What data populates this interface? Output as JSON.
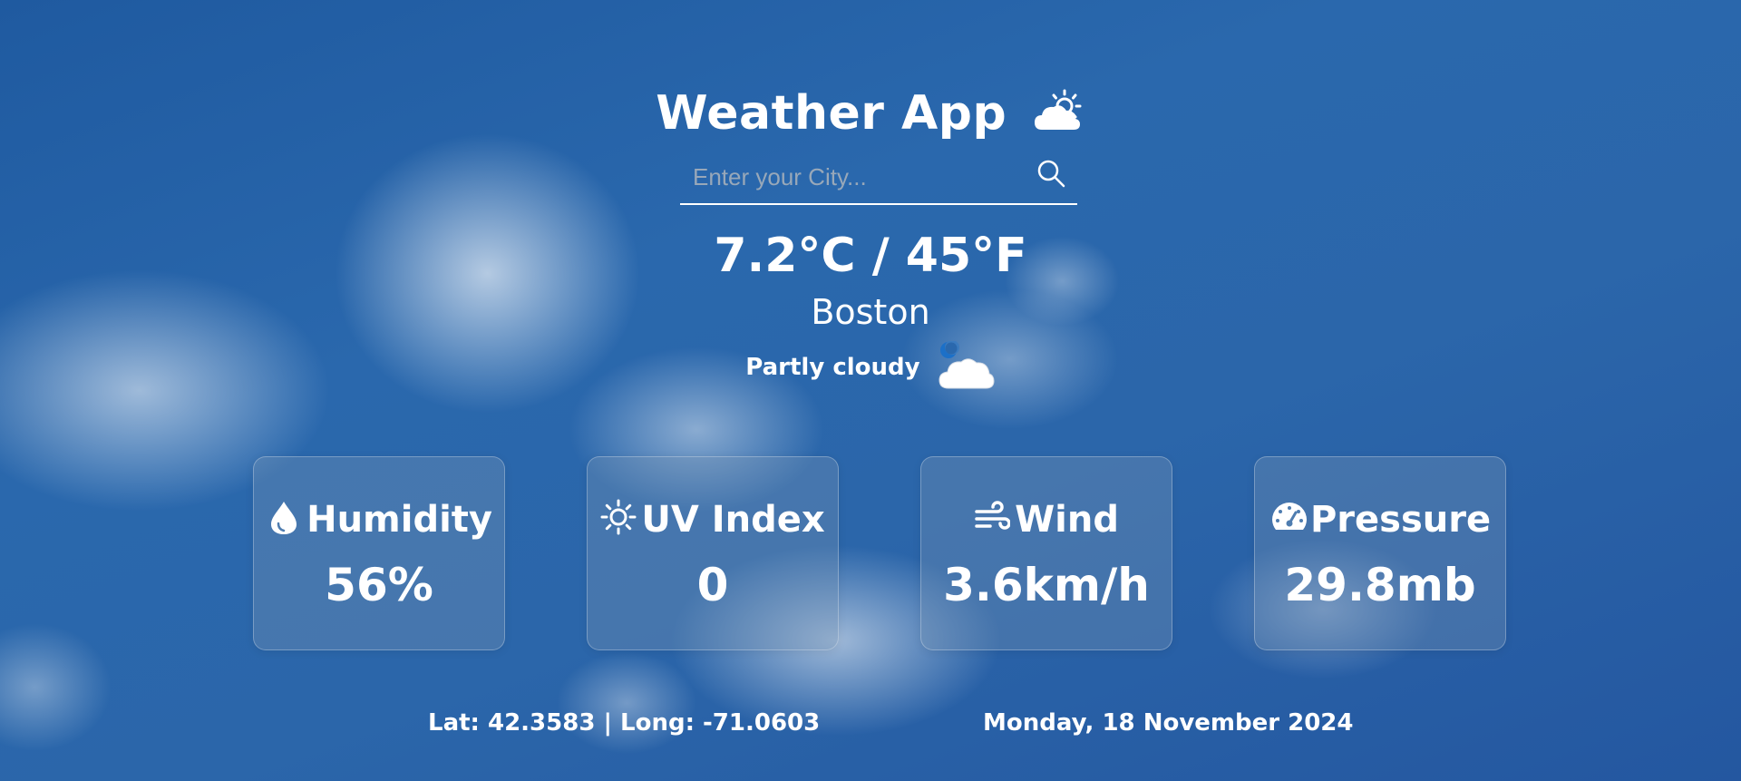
{
  "app": {
    "title": "Weather App",
    "title_icon": "sun-behind-cloud-icon"
  },
  "search": {
    "placeholder": "Enter your City...",
    "value": "",
    "button_icon": "search-icon"
  },
  "current": {
    "temperature": "7.2°C / 45°F",
    "city": "Boston",
    "condition": "Partly cloudy",
    "condition_icon": "moon-cloud-icon"
  },
  "stats": [
    {
      "icon": "droplet-icon",
      "label": "Humidity",
      "value": "56%"
    },
    {
      "icon": "sun-icon",
      "label": "UV Index",
      "value": "0"
    },
    {
      "icon": "wind-icon",
      "label": "Wind",
      "value": "3.6km/h"
    },
    {
      "icon": "gauge-icon",
      "label": "Pressure",
      "value": "29.8mb"
    }
  ],
  "footer": {
    "coords": "Lat: 42.3583 | Long: -71.0603",
    "date": "Monday, 18 November 2024"
  },
  "colors": {
    "text": "#ffffff",
    "sky": "#2a68ad",
    "card_background": "rgba(120,150,180,0.35)"
  }
}
